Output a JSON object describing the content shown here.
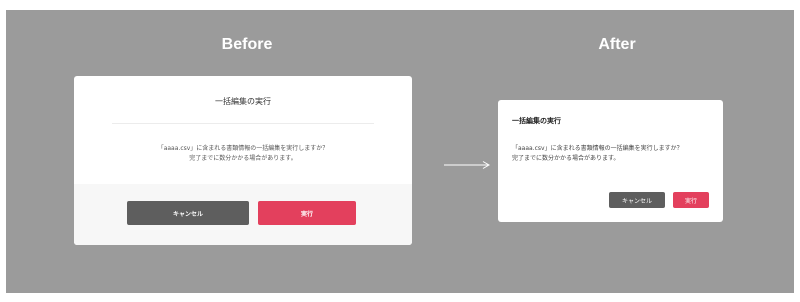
{
  "before": {
    "heading": "Before",
    "dialog": {
      "title": "一括編集の実行",
      "message_line1": "「aaaa.csv」に含まれる書類情報の一括編集を実行しますか？",
      "message_line2": "完了までに数分かかる場合があります。",
      "cancel_label": "キャンセル",
      "execute_label": "実行"
    }
  },
  "after": {
    "heading": "After",
    "dialog": {
      "title": "一括編集の実行",
      "message_line1": "「aaaa.csv」に含まれる書類情報の一括編集を実行しますか？",
      "message_line2": "完了までに数分かかる場合があります。",
      "cancel_label": "キャンセル",
      "execute_label": "実行"
    }
  },
  "colors": {
    "background": "#9b9b9b",
    "cancel_button": "#5e5e5e",
    "execute_button": "#e3405d"
  },
  "icons": {
    "arrow": "right-arrow-icon"
  }
}
